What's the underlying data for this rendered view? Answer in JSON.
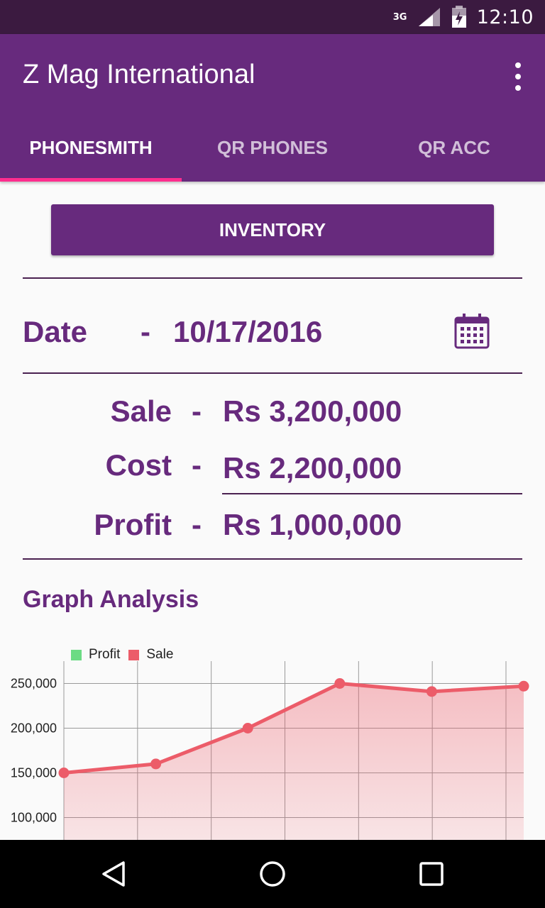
{
  "status_bar": {
    "network": "3G",
    "time": "12:10"
  },
  "app_bar": {
    "title": "Z Mag International"
  },
  "tabs": [
    {
      "label": "PHONESMITH",
      "active": true
    },
    {
      "label": "QR PHONES",
      "active": false
    },
    {
      "label": "QR ACC",
      "active": false
    }
  ],
  "inventory_button": "INVENTORY",
  "date_row": {
    "label": "Date",
    "dash": "-",
    "value": "10/17/2016"
  },
  "summary": [
    {
      "label": "Sale",
      "dash": "-",
      "value": "Rs 3,200,000"
    },
    {
      "label": "Cost",
      "dash": "-",
      "value": "Rs 2,200,000"
    },
    {
      "label": "Profit",
      "dash": "-",
      "value": "Rs 1,000,000"
    }
  ],
  "graph_title": "Graph Analysis",
  "colors": {
    "primary": "#672a7d",
    "status_bar": "#3b1a40",
    "tab_indicator": "#ff2d8e",
    "profit": "#6cdb84",
    "sale": "#ec5c69"
  },
  "chart_data": {
    "type": "area",
    "legend_position": "top-left",
    "grid": true,
    "yticks": [
      "250,000",
      "200,000",
      "150,000",
      "100,000"
    ],
    "ylim": [
      75000,
      275000
    ],
    "series": [
      {
        "name": "Profit",
        "values": []
      },
      {
        "name": "Sale",
        "values": [
          150000,
          160000,
          200000,
          250000,
          241000,
          247000
        ]
      }
    ]
  }
}
